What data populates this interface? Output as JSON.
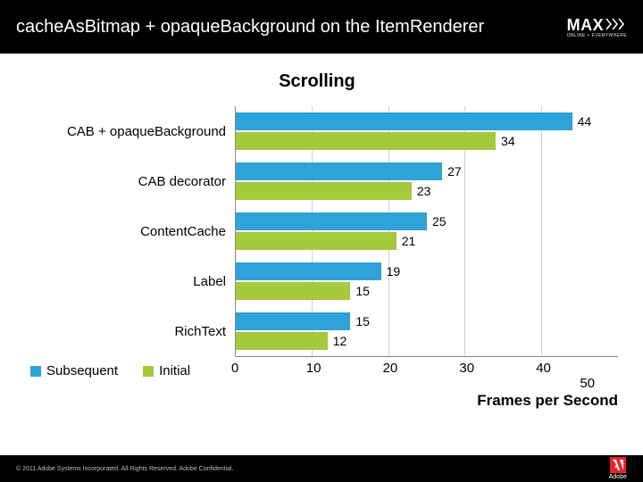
{
  "header": {
    "title": "cacheAsBitmap + opaqueBackground on the ItemRenderer",
    "logo_main": "MAX",
    "logo_sub": "ONLINE + EVERYWHERE"
  },
  "chart_data": {
    "type": "bar",
    "title": "Scrolling",
    "xlabel": "Frames per Second",
    "xlim": [
      0,
      50
    ],
    "x_ticks": [
      "0",
      "10",
      "20",
      "30",
      "40",
      "50"
    ],
    "categories": [
      "CAB + opaqueBackground",
      "CAB decorator",
      "ContentCache",
      "Label",
      "RichText"
    ],
    "series": [
      {
        "name": "Subsequent",
        "color": "#2ea3d8",
        "values": [
          44,
          27,
          25,
          19,
          15
        ]
      },
      {
        "name": "Initial",
        "color": "#a4c93a",
        "values": [
          34,
          23,
          21,
          15,
          12
        ]
      }
    ]
  },
  "legend": {
    "subsequent": "Subsequent",
    "initial": "Initial"
  },
  "footer": {
    "copyright": "© 2011 Adobe Systems Incorporated. All Rights Reserved. Adobe Confidential.",
    "brand": "Adobe"
  }
}
